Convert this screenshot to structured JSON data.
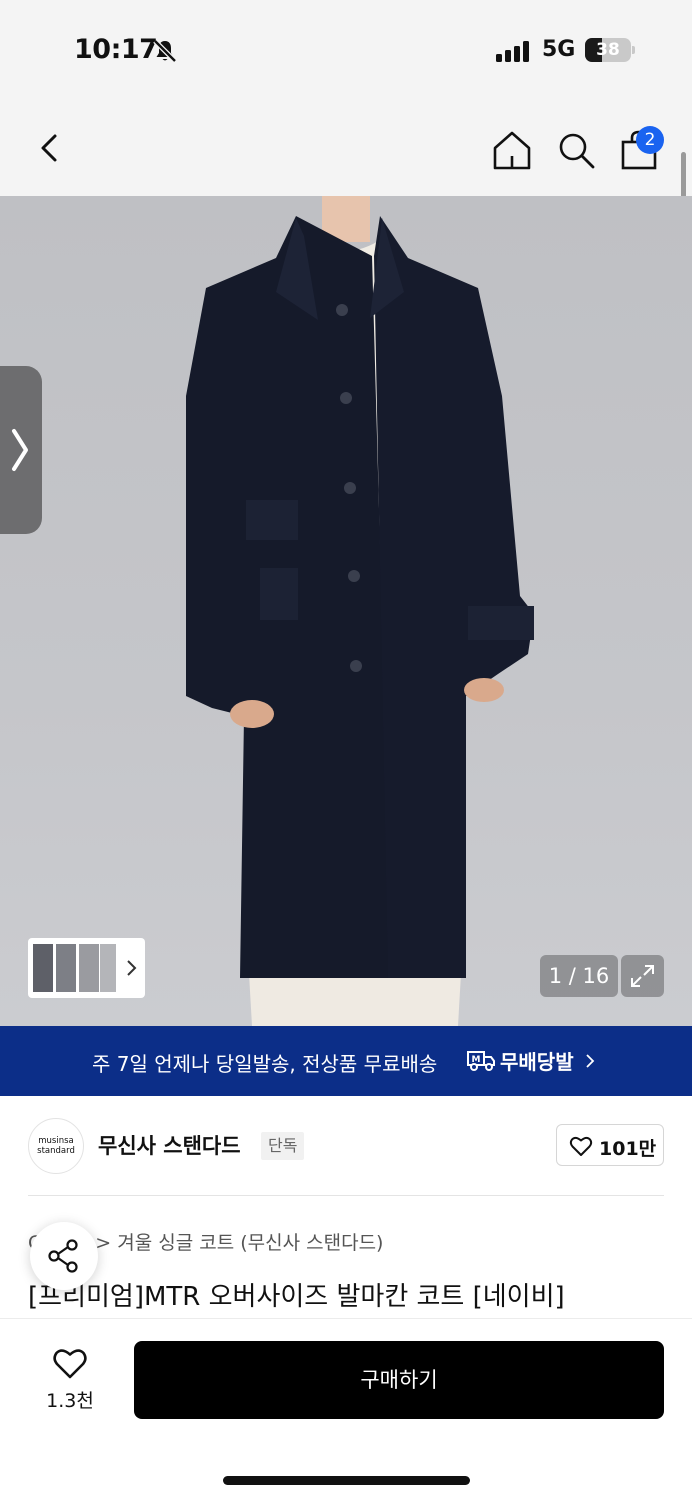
{
  "status_bar": {
    "time": "10:17",
    "network": "5G",
    "battery": "38",
    "battery_level": 0.38
  },
  "nav": {
    "back_icon": "chevron-left-icon",
    "home_icon": "home-icon",
    "search_icon": "search-icon",
    "cart_icon": "shopping-bag-icon",
    "cart_badge": "2",
    "badge_color": "#1a63f0"
  },
  "gallery": {
    "counter": "1 / 16",
    "expand_icon": "expand-icon"
  },
  "banner": {
    "text": "주 7일 언제나 당일발송, 전상품 무료배송",
    "brand": "무배당발",
    "background": "#0c2e88"
  },
  "brand": {
    "logo_line1": "musinsa",
    "logo_line2": "standard",
    "name": "무신사 스탠다드",
    "tag": "단독",
    "likes": "101만"
  },
  "product": {
    "breadcrumb": "> 겨울 싱글 코트 (무신사 스탠다드)",
    "title": "[프리미엄]MTR 오버사이즈 발마칸 코트 [네이비]"
  },
  "bottom": {
    "wish_count": "1.3천",
    "buy_label": "구매하기"
  }
}
